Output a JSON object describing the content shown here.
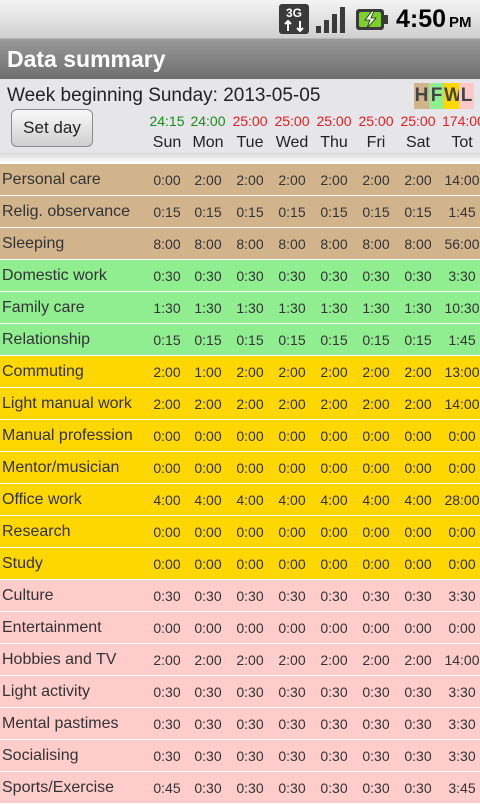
{
  "status_bar": {
    "network_label": "3G",
    "time": "4:50",
    "ampm": "PM",
    "icons": [
      "3g-data-icon",
      "signal-icon",
      "battery-charging-icon"
    ]
  },
  "app": {
    "title": "Data summary"
  },
  "header": {
    "week_label": "Week beginning Sunday: 2013-05-05",
    "set_day_label": "Set day",
    "legend": [
      {
        "letter": "H",
        "color": "#d2b48c"
      },
      {
        "letter": "F",
        "color": "#90ee90"
      },
      {
        "letter": "W",
        "color": "#ffd700"
      },
      {
        "letter": "L",
        "color": "#ffc8c8"
      }
    ],
    "days": [
      "Sun",
      "Mon",
      "Tue",
      "Wed",
      "Thu",
      "Fri",
      "Sat",
      "Tot"
    ],
    "totals": [
      "24:15",
      "24:00",
      "25:00",
      "25:00",
      "25:00",
      "25:00",
      "25:00",
      "174:00"
    ],
    "total_colors": [
      "#1a8a1a",
      "#1a8a1a",
      "#e02020",
      "#e02020",
      "#e02020",
      "#e02020",
      "#e02020",
      "#e02020"
    ]
  },
  "categories": {
    "H": "#d2b48c",
    "F": "#90ee90",
    "W": "#ffd700",
    "L": "#ffcccc"
  },
  "rows": [
    {
      "label": "Personal care",
      "cat": "H",
      "values": [
        "0:00",
        "2:00",
        "2:00",
        "2:00",
        "2:00",
        "2:00",
        "2:00",
        "14:00"
      ]
    },
    {
      "label": "Relig. observance",
      "cat": "H",
      "values": [
        "0:15",
        "0:15",
        "0:15",
        "0:15",
        "0:15",
        "0:15",
        "0:15",
        "1:45"
      ]
    },
    {
      "label": "Sleeping",
      "cat": "H",
      "values": [
        "8:00",
        "8:00",
        "8:00",
        "8:00",
        "8:00",
        "8:00",
        "8:00",
        "56:00"
      ]
    },
    {
      "label": "Domestic work",
      "cat": "F",
      "values": [
        "0:30",
        "0:30",
        "0:30",
        "0:30",
        "0:30",
        "0:30",
        "0:30",
        "3:30"
      ]
    },
    {
      "label": "Family care",
      "cat": "F",
      "values": [
        "1:30",
        "1:30",
        "1:30",
        "1:30",
        "1:30",
        "1:30",
        "1:30",
        "10:30"
      ]
    },
    {
      "label": "Relationship",
      "cat": "F",
      "values": [
        "0:15",
        "0:15",
        "0:15",
        "0:15",
        "0:15",
        "0:15",
        "0:15",
        "1:45"
      ]
    },
    {
      "label": "Commuting",
      "cat": "W",
      "values": [
        "2:00",
        "1:00",
        "2:00",
        "2:00",
        "2:00",
        "2:00",
        "2:00",
        "13:00"
      ]
    },
    {
      "label": "Light manual work",
      "cat": "W",
      "values": [
        "2:00",
        "2:00",
        "2:00",
        "2:00",
        "2:00",
        "2:00",
        "2:00",
        "14:00"
      ]
    },
    {
      "label": "Manual profession",
      "cat": "W",
      "values": [
        "0:00",
        "0:00",
        "0:00",
        "0:00",
        "0:00",
        "0:00",
        "0:00",
        "0:00"
      ]
    },
    {
      "label": "Mentor/musician",
      "cat": "W",
      "values": [
        "0:00",
        "0:00",
        "0:00",
        "0:00",
        "0:00",
        "0:00",
        "0:00",
        "0:00"
      ]
    },
    {
      "label": "Office work",
      "cat": "W",
      "values": [
        "4:00",
        "4:00",
        "4:00",
        "4:00",
        "4:00",
        "4:00",
        "4:00",
        "28:00"
      ]
    },
    {
      "label": "Research",
      "cat": "W",
      "values": [
        "0:00",
        "0:00",
        "0:00",
        "0:00",
        "0:00",
        "0:00",
        "0:00",
        "0:00"
      ]
    },
    {
      "label": "Study",
      "cat": "W",
      "values": [
        "0:00",
        "0:00",
        "0:00",
        "0:00",
        "0:00",
        "0:00",
        "0:00",
        "0:00"
      ]
    },
    {
      "label": "Culture",
      "cat": "L",
      "values": [
        "0:30",
        "0:30",
        "0:30",
        "0:30",
        "0:30",
        "0:30",
        "0:30",
        "3:30"
      ]
    },
    {
      "label": "Entertainment",
      "cat": "L",
      "values": [
        "0:00",
        "0:00",
        "0:00",
        "0:00",
        "0:00",
        "0:00",
        "0:00",
        "0:00"
      ]
    },
    {
      "label": "Hobbies and TV",
      "cat": "L",
      "values": [
        "2:00",
        "2:00",
        "2:00",
        "2:00",
        "2:00",
        "2:00",
        "2:00",
        "14:00"
      ]
    },
    {
      "label": "Light activity",
      "cat": "L",
      "values": [
        "0:30",
        "0:30",
        "0:30",
        "0:30",
        "0:30",
        "0:30",
        "0:30",
        "3:30"
      ]
    },
    {
      "label": "Mental pastimes",
      "cat": "L",
      "values": [
        "0:30",
        "0:30",
        "0:30",
        "0:30",
        "0:30",
        "0:30",
        "0:30",
        "3:30"
      ]
    },
    {
      "label": "Socialising",
      "cat": "L",
      "values": [
        "0:30",
        "0:30",
        "0:30",
        "0:30",
        "0:30",
        "0:30",
        "0:30",
        "3:30"
      ]
    },
    {
      "label": "Sports/Exercise",
      "cat": "L",
      "values": [
        "0:45",
        "0:30",
        "0:30",
        "0:30",
        "0:30",
        "0:30",
        "0:30",
        "3:45"
      ]
    }
  ]
}
